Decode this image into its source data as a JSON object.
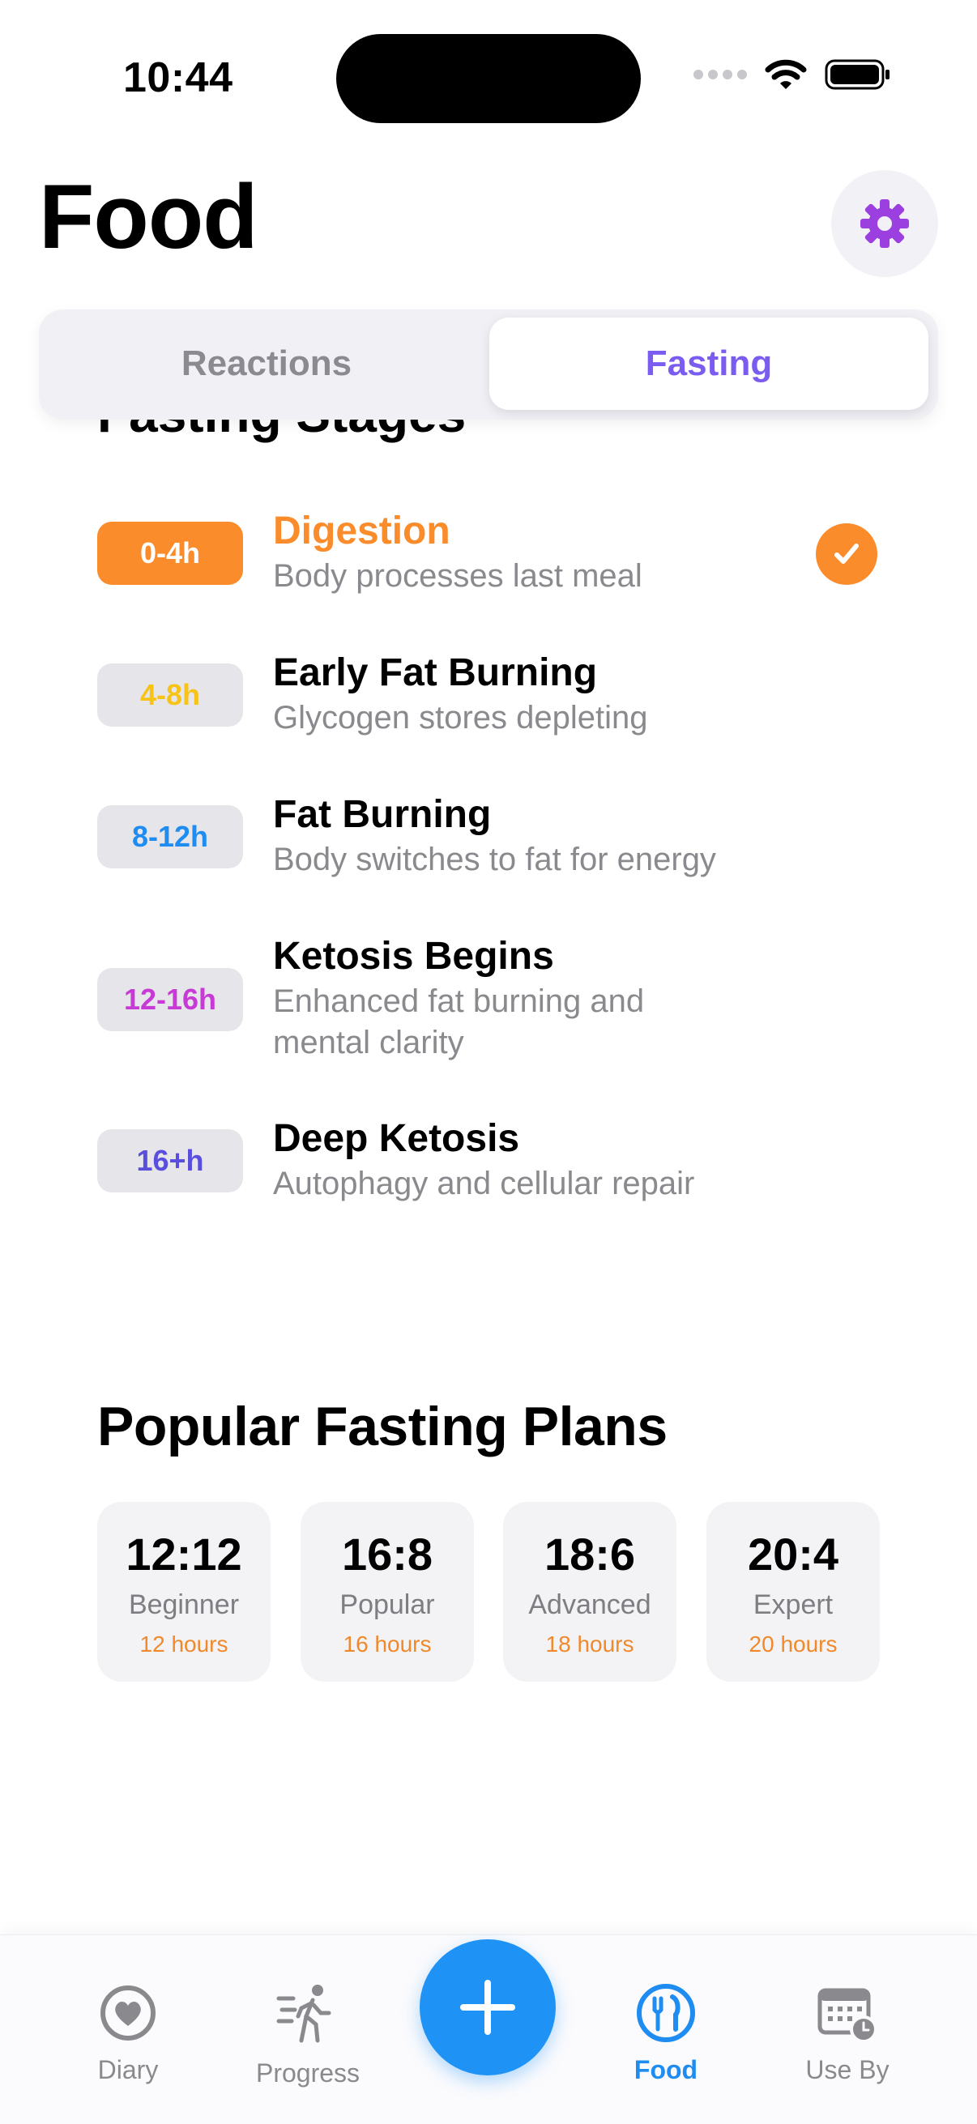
{
  "status_bar": {
    "time": "10:44"
  },
  "header": {
    "title": "Food"
  },
  "segments": {
    "left": "Reactions",
    "right": "Fasting",
    "selected": "Fasting"
  },
  "stages_section": {
    "title": "Fasting Stages"
  },
  "stages": [
    {
      "range": "0-4h",
      "name": "Digestion",
      "desc": "Body processes last meal",
      "color": "#fb8c2b",
      "active": true
    },
    {
      "range": "4-8h",
      "name": "Early Fat Burning",
      "desc": "Glycogen stores depleting",
      "color": "#f7c316",
      "active": false
    },
    {
      "range": "8-12h",
      "name": "Fat Burning",
      "desc": "Body switches to fat for energy",
      "color": "#1e8cf0",
      "active": false
    },
    {
      "range": "12-16h",
      "name": "Ketosis Begins",
      "desc": "Enhanced fat burning and mental clarity",
      "color": "#c73ad6",
      "active": false
    },
    {
      "range": "16+h",
      "name": "Deep Ketosis",
      "desc": "Autophagy and cellular repair",
      "color": "#5a4fdc",
      "active": false
    }
  ],
  "plans_section": {
    "title": "Popular Fasting Plans"
  },
  "plans": [
    {
      "ratio": "12:12",
      "level": "Beginner",
      "hours": "12 hours"
    },
    {
      "ratio": "16:8",
      "level": "Popular",
      "hours": "16 hours"
    },
    {
      "ratio": "18:6",
      "level": "Advanced",
      "hours": "18 hours"
    },
    {
      "ratio": "20:4",
      "level": "Expert",
      "hours": "20 hours"
    }
  ],
  "tabbar": {
    "items": [
      {
        "label": "Diary",
        "icon": "heart-icon"
      },
      {
        "label": "Progress",
        "icon": "walking-figure-icon"
      },
      {
        "label": "Food",
        "icon": "fork-knife-icon",
        "active": true
      },
      {
        "label": "Use By",
        "icon": "calendar-clock-icon"
      }
    ],
    "add_icon": "plus-icon"
  },
  "colors": {
    "accent_purple": "#7a5cf0",
    "accent_blue": "#1f93f5",
    "accent_orange": "#fb8c2b"
  }
}
